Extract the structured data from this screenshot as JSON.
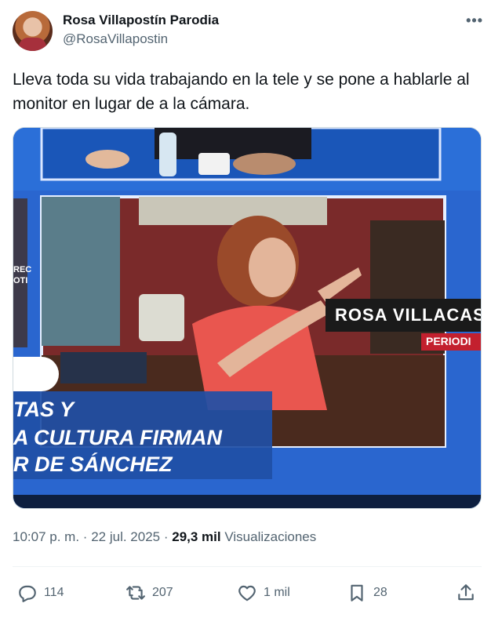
{
  "author": {
    "display_name": "Rosa Villapostín Parodia",
    "handle": "@RosaVillapostin"
  },
  "more_icon": "more-dots-icon",
  "tweet": {
    "text": "Lleva toda su vida trabajando en la tele y se pone a hablarle al monitor en lugar de a la cámara."
  },
  "media": {
    "lower_third_line1": "TAS Y",
    "lower_third_line2": "A CULTURA FIRMAN",
    "lower_third_line3": "R DE SÁNCHEZ",
    "name_tag": "ROSA VILLACAST",
    "role_tag": "PERIODI",
    "side_sign": "REC\nOTI",
    "colors": {
      "frame_blue": "#1f5ec8",
      "wall_red": "#7a2a2a",
      "shirt_red": "#e9564f",
      "role_tag_red": "#c3202e"
    }
  },
  "meta": {
    "time": "10:07 p. m.",
    "separator": "·",
    "date": "22 jul. 2025",
    "views_count": "29,3 mil",
    "views_label": "Visualizaciones"
  },
  "actions": {
    "replies": "114",
    "retweets": "207",
    "likes": "1 mil",
    "bookmarks": "28",
    "icons": [
      "reply-icon",
      "retweet-icon",
      "like-icon",
      "bookmark-icon",
      "share-icon"
    ]
  }
}
